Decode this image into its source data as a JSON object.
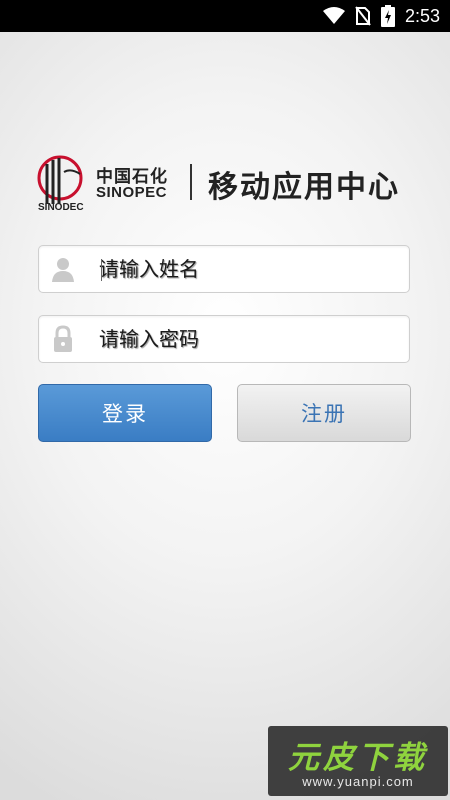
{
  "status_bar": {
    "time": "2:53"
  },
  "header": {
    "logo_cn": "中国石化",
    "logo_en": "SINOPEC",
    "logo_emblem_text": "SINODEC",
    "app_title": "移动应用中心"
  },
  "form": {
    "username_placeholder": "请输入姓名",
    "password_placeholder": "请输入密码",
    "login_label": "登录",
    "register_label": "注册"
  },
  "watermark": {
    "brand": "元皮下载",
    "url": "www.yuanpi.com"
  },
  "colors": {
    "accent": "#4a8bd0",
    "login_button": "#4a8bd0",
    "register_text": "#3b74b4",
    "watermark_green": "#8fd33e"
  }
}
